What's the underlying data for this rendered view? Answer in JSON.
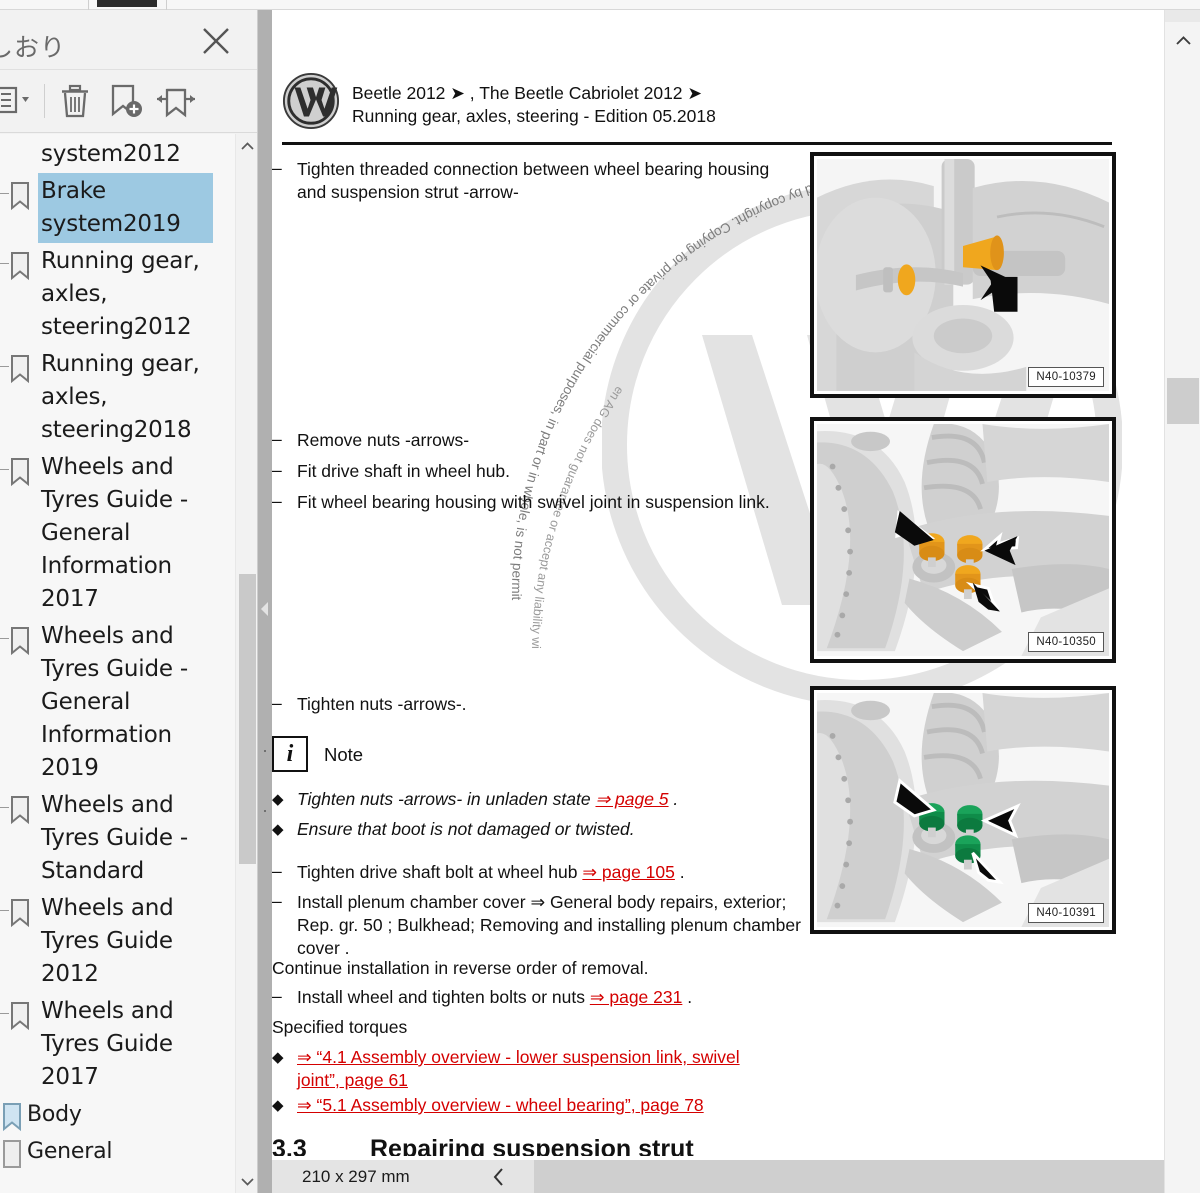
{
  "window": {
    "tab_active_label": ""
  },
  "bookmark_panel": {
    "title": "しおり",
    "close_icon": "close-icon",
    "toolbar": {
      "options_label": "",
      "options_icon": "list-options-icon",
      "delete_icon": "trash-icon",
      "add_bookmark_icon": "add-bookmark-icon",
      "expand_collapse_icon": "expand-collapse-bookmarks-icon"
    },
    "items": [
      {
        "label": "system2012",
        "selected": false,
        "partial_top": true
      },
      {
        "label": "Brake system2019",
        "selected": true,
        "partial_top": false
      },
      {
        "label": "Running gear, axles, steering2012",
        "selected": false,
        "partial_top": false
      },
      {
        "label": "Running gear, axles, steering2018",
        "selected": false,
        "partial_top": false
      },
      {
        "label": "Wheels and Tyres Guide - General Information 2017",
        "selected": false,
        "partial_top": false
      },
      {
        "label": "Wheels and Tyres Guide - General Information 2019",
        "selected": false,
        "partial_top": false
      },
      {
        "label": "Wheels and Tyres Guide - Standard",
        "selected": false,
        "partial_top": false
      },
      {
        "label": "Wheels and Tyres Guide 2012",
        "selected": false,
        "partial_top": false
      },
      {
        "label": "Wheels and Tyres Guide 2017",
        "selected": false,
        "partial_top": false
      },
      {
        "label": "Body",
        "selected": false,
        "partial_top": false
      },
      {
        "label": "General",
        "selected": false,
        "partial_top": false
      }
    ],
    "scroll_up_icon": "chevron-up-icon",
    "scroll_down_icon": "chevron-down-icon"
  },
  "document": {
    "header": {
      "logo": "vw-logo",
      "line1": "Beetle 2012 ➤ , The Beetle Cabriolet 2012 ➤",
      "line2": "Running gear, axles, steering - Edition 05.2018"
    },
    "watermark": "Protected by copyright. Copying for private or commercial purposes, in part or in whole, is not permitted unless authorised by Volkswagen AG. Volkswagen AG does not guarantee or accept any liability with respect to the correctness of information in this document. Copyright by Volkswagen AG.",
    "blocks": {
      "b1": "Tighten threaded connection between wheel bearing housing and suspension strut -arrow-",
      "b2": "Remove nuts -arrows-",
      "b3": "Fit drive shaft in wheel hub.",
      "b4": "Fit wheel bearing housing with swivel joint in suspension link.",
      "b5": "Tighten nuts -arrows-.",
      "note_label": "Note",
      "note_icon_glyph": "i",
      "n1_pre": "Tighten nuts -arrows- in unladen state ",
      "n1_link": "⇒ page 5",
      "n1_post": " .",
      "n2": "Ensure that boot is not damaged or twisted.",
      "b6_pre": "Tighten drive shaft bolt at wheel hub ",
      "b6_link": "⇒ page 105",
      "b6_post": " .",
      "b7": "Install plenum chamber cover ⇒  General body repairs, exterior; Rep. gr.  50 ; Bulkhead; Removing and installing plenum chamber cover .",
      "b8": "Continue installation in reverse order of removal.",
      "b9_pre": "Install wheel and tighten bolts or nuts ",
      "b9_link": "⇒ page 231",
      "b9_post": " .",
      "torque_heading": "Specified torques",
      "t1": "⇒ “4.1 Assembly overview - lower suspension link, swivel joint”, page 61",
      "t2": "⇒ “5.1 Assembly overview - wheel bearing”, page 78",
      "section_number": "3.3",
      "section_title": "Repairing suspension strut"
    },
    "figures": [
      {
        "caption": "N40-10379",
        "marker_color": "#f0a71e"
      },
      {
        "caption": "N40-10350",
        "marker_color": "#f0a71e"
      },
      {
        "caption": "N40-10391",
        "marker_color": "#0f9d58"
      }
    ]
  },
  "statusbar": {
    "page_size": "210 x 297 mm",
    "prev_icon": "chevron-left-icon"
  },
  "right_scrollbar": {
    "up_icon": "chevron-up-icon"
  },
  "colors": {
    "selection": "#9dc9e2",
    "link": "#d40000",
    "splitter": "#b0b0b0"
  }
}
